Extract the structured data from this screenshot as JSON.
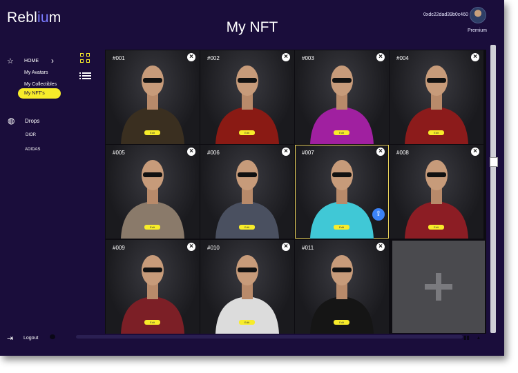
{
  "app": {
    "logo_start": "Rebl",
    "logo_accent": "iu",
    "logo_end": "m",
    "page_title": "My NFT"
  },
  "header": {
    "wallet": "0xdc22dad39b0c460",
    "premium": "Premium",
    "avatar_icon": "user-avatar"
  },
  "sidebar": {
    "home": "HOME",
    "home_icon": "star-icon",
    "items": [
      "My Avatars",
      "My Collectibles",
      "My NFT's"
    ],
    "active": "My NFT's",
    "drops": "Drops",
    "drops_icon": "globe-icon",
    "drop_items": [
      "DIOR",
      "ADIDAS"
    ],
    "logout": "Logout",
    "accent_color": "#f7ec2a"
  },
  "view_toggles": {
    "grid_icon": "grid-view-icon",
    "list_icon": "list-view-icon",
    "active": "grid"
  },
  "cards": [
    {
      "num": "#001",
      "edit": "Edit",
      "selected": false,
      "color": "#3a2f20"
    },
    {
      "num": "#002",
      "edit": "Edit",
      "selected": false,
      "color": "#8a1a14"
    },
    {
      "num": "#003",
      "edit": "Edit",
      "selected": false,
      "color": "#a020a0"
    },
    {
      "num": "#004",
      "edit": "Edit",
      "selected": false,
      "color": "#8c1b1b"
    },
    {
      "num": "#005",
      "edit": "Edit",
      "selected": false,
      "color": "#8a7a6a"
    },
    {
      "num": "#006",
      "edit": "Edit",
      "selected": false,
      "color": "#4a5060"
    },
    {
      "num": "#007",
      "edit": "Edit",
      "selected": true,
      "color": "#40c8d6"
    },
    {
      "num": "#008",
      "edit": "Edit",
      "selected": false,
      "color": "#8c1d24"
    },
    {
      "num": "#009",
      "edit": "Edit",
      "selected": false,
      "color": "#7c1f26"
    },
    {
      "num": "#010",
      "edit": "Edit",
      "selected": false,
      "color": "#dcdcdc"
    },
    {
      "num": "#011",
      "edit": "Edit",
      "selected": false,
      "color": "#151515"
    }
  ],
  "add_card_icon": "plus-icon",
  "upload_icon": "upload-icon",
  "logout_icon": "logout-icon"
}
